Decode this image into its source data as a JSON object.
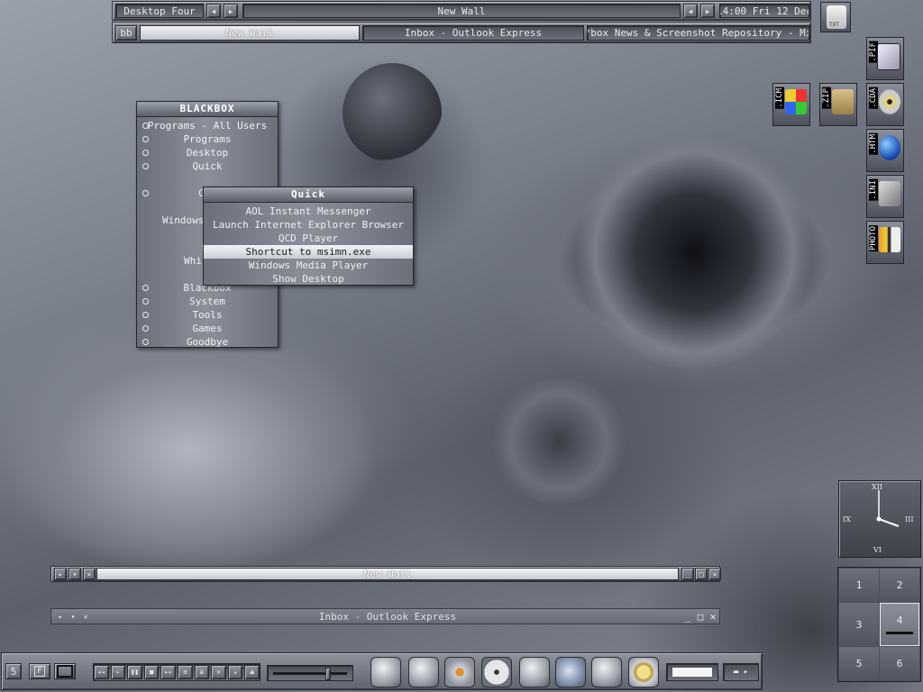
{
  "toolbar": {
    "workspace": "Desktop Four",
    "current_window": "New Wall",
    "clock": "14:00 Fri 12 Dec",
    "prev_icon": "left-arrow-icon",
    "next_icon": "right-arrow-icon"
  },
  "taskbar": {
    "bb_label": "bb",
    "tasks": [
      {
        "label": "New Wall",
        "active": true
      },
      {
        "label": "Inbox - Outlook Express",
        "active": false
      },
      {
        "label": "*box News & Screenshot Repository - Mi",
        "active": false
      }
    ]
  },
  "desktop_icons": [
    {
      "label": ".PIF",
      "icon": "shortcut-file-icon"
    },
    {
      "label": ".ICM",
      "icon": "color-profile-icon"
    },
    {
      "label": ".ZIP",
      "icon": "zip-archive-icon"
    },
    {
      "label": ".CDA",
      "icon": "cd-audio-icon"
    },
    {
      "label": ".HTM",
      "icon": "html-document-icon"
    },
    {
      "label": ".INI",
      "icon": "settings-file-icon"
    },
    {
      "label": "PHOTO",
      "icon": "photo-file-icon"
    },
    {
      "label": "TXT",
      "icon": "text-file-icon"
    }
  ],
  "blackbox_menu": {
    "title": "BLACKBOX",
    "items": [
      "Programs - All Users",
      "Programs",
      "Desktop",
      "Quick",
      "",
      "Com",
      "",
      "Windows",
      "",
      "St",
      "Whi",
      "",
      "Blackbox",
      "System",
      "Tools",
      "Games",
      "Goodbye"
    ]
  },
  "quick_menu": {
    "title": "Quick",
    "items": [
      "AOL Instant Messenger",
      "Launch Internet Explorer Browser",
      "QCD Player",
      "Shortcut to msimn.exe",
      "Windows Media Player",
      "Show Desktop"
    ],
    "selected_index": 3
  },
  "windows": [
    {
      "title": "New Wall"
    },
    {
      "title": "Inbox - Outlook Express"
    }
  ],
  "clock_widget": {
    "numerals": [
      "XII",
      "III",
      "VI",
      "IX"
    ]
  },
  "pager": {
    "desktops": [
      "1",
      "2",
      "3",
      "4",
      "5",
      "6"
    ],
    "active": "4"
  },
  "dock": {
    "left_buttons": [
      "5",
      "F",
      ""
    ],
    "media_controls": [
      "rewind-icon",
      "play-icon",
      "pause-icon",
      "stop-icon",
      "forward-icon",
      "playlist-icon",
      "equalizer-icon",
      "shuffle-icon",
      "volume-up-icon",
      "eject-icon"
    ],
    "volume": 0.72,
    "apps": [
      "explorer-icon",
      "drive-icon",
      "tools-icon",
      "film-reel-icon",
      "folder-icon",
      "window-manager-icon",
      "documents-icon",
      "moon-icon"
    ]
  }
}
